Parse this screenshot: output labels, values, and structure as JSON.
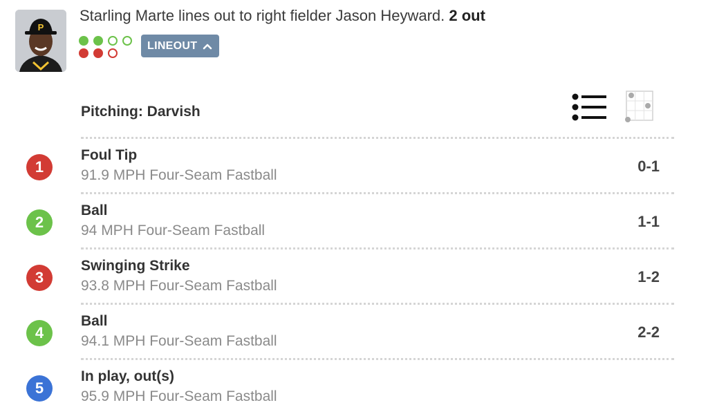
{
  "play": {
    "description": "Starling Marte lines out to right fielder Jason Heyward.",
    "outs": "2 out",
    "result_label": "LINEOUT",
    "chevron_icon": "chevron-up-icon",
    "balls_shown": 2,
    "balls_max": 4,
    "strikes_shown": 2,
    "strikes_max": 3
  },
  "pitching": {
    "label": "Pitching: Darvish"
  },
  "view_toggles": {
    "list_icon": "list-icon",
    "zone_icon": "strike-zone-icon"
  },
  "colors": {
    "ball": "#6cc24a",
    "strike": "#d23b34",
    "in_play": "#3b73d6",
    "button": "#6f8aa6"
  },
  "pitches": [
    {
      "number": "1",
      "type": "strike",
      "name": "Foul Tip",
      "desc": "91.9 MPH Four-Seam Fastball",
      "count": "0-1"
    },
    {
      "number": "2",
      "type": "ball",
      "name": "Ball",
      "desc": "94 MPH Four-Seam Fastball",
      "count": "1-1"
    },
    {
      "number": "3",
      "type": "strike",
      "name": "Swinging Strike",
      "desc": "93.8 MPH Four-Seam Fastball",
      "count": "1-2"
    },
    {
      "number": "4",
      "type": "ball",
      "name": "Ball",
      "desc": "94.1 MPH Four-Seam Fastball",
      "count": "2-2"
    },
    {
      "number": "5",
      "type": "in_play",
      "name": "In play, out(s)",
      "desc": "95.9 MPH Four-Seam Fastball",
      "count": ""
    }
  ]
}
